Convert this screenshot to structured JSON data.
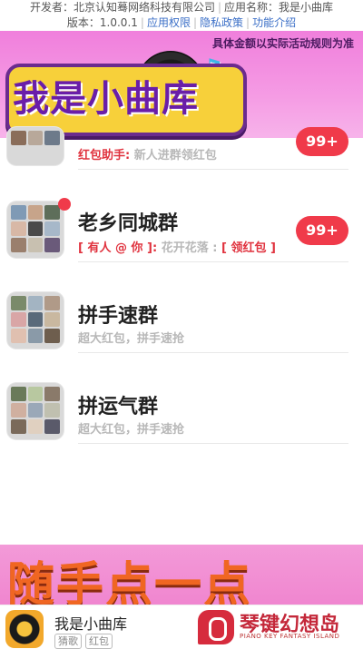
{
  "top_info": {
    "developer": "开发者：北京认知蓦网络科技有限公司",
    "app_label": "应用名称：我是小曲库",
    "version": "版本：1.0.0.1",
    "link_permissions": "应用权限",
    "link_privacy": "隐私政策",
    "link_features": "功能介绍"
  },
  "hero": {
    "disclaimer": "具体金额以实际活动规则为准",
    "title": "我是小曲库"
  },
  "chat_list": [
    {
      "name": "",
      "message_prefix": "红包助手:",
      "message": "新人进群领红包",
      "badge": "99+"
    },
    {
      "name": "老乡同城群",
      "message_prefix": "[ 有人 @ 你 ]:",
      "message": "花开花落 :",
      "message_suffix": "[ 领红包 ]",
      "badge": "99+"
    },
    {
      "name": "拼手速群",
      "message": "超大红包，拼手速抢"
    },
    {
      "name": "拼运气群",
      "message": "超大红包，拼手速抢"
    }
  ],
  "bottom_banner": {
    "slogan": "随手点一点"
  },
  "app_bar": {
    "app_name": "我是小曲库",
    "tags": [
      "猜歌",
      "红包"
    ]
  },
  "brand": {
    "name": "琴键幻想岛",
    "subtitle": "PIANO KEY FANTASY ISLAND"
  },
  "colors": {
    "hero_pink": "#f07fdc",
    "badge_red": "#f03a4a",
    "title_yellow": "#f7d03a",
    "title_purple": "#6a1ea8",
    "slogan_orange": "#f06622",
    "brand_red": "#c4283a"
  }
}
